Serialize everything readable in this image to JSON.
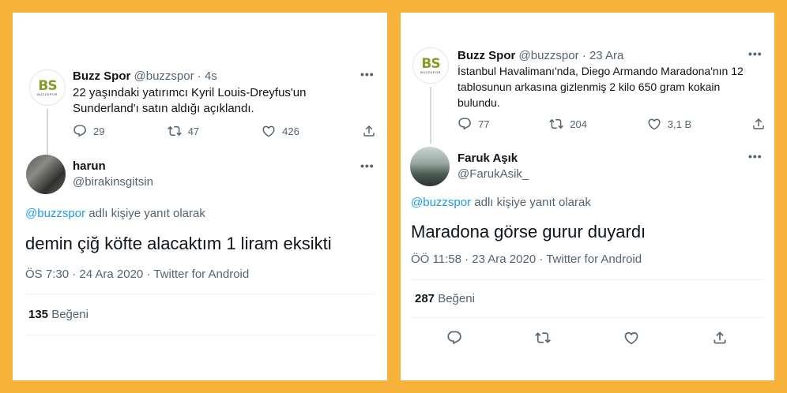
{
  "left": {
    "parent_tweet": {
      "avatar": {
        "letters": "BS",
        "sub": "BUZZSPOR"
      },
      "display_name": "Buzz Spor",
      "handle": "@buzzspor",
      "time": "· 4s",
      "text": "22 yaşındaki yatırımcı Kyril Louis-Dreyfus'un Sunderland'ı satın aldığı açıklandı.",
      "replies": "29",
      "retweets": "47",
      "likes": "426"
    },
    "reply_tweet": {
      "display_name": "harun",
      "handle": "@birakinsgitsin",
      "reply_mention": "@buzzspor",
      "reply_suffix": "adlı kişiye yanıt olarak",
      "text": "demin çiğ köfte alacaktım 1 liram eksikti",
      "meta": "ÖS 7:30 · 24 Ara 2020 · Twitter for Android",
      "likes_count": "135",
      "likes_label": "Beğeni"
    }
  },
  "right": {
    "parent_tweet": {
      "avatar": {
        "letters": "BS",
        "sub": "BUZZSPOR"
      },
      "display_name": "Buzz Spor",
      "handle": "@buzzspor",
      "time": "· 23 Ara",
      "text": "İstanbul Havalimanı'nda, Diego Armando Maradona'nın 12 tablosunun arkasına gizlenmiş 2 kilo 650 gram kokain bulundu.",
      "replies": "77",
      "retweets": "204",
      "likes": "3,1 B"
    },
    "reply_tweet": {
      "display_name": "Faruk Aşık",
      "handle": "@FarukAsik_",
      "reply_mention": "@buzzspor",
      "reply_suffix": "adlı kişiye yanıt olarak",
      "text": "Maradona görse gurur duyardı",
      "meta": "ÖÖ 11:58 · 23 Ara 2020 · Twitter for Android",
      "likes_count": "287",
      "likes_label": "Beğeni"
    }
  },
  "more_glyph": "•••",
  "colors": {
    "background": "#f7b23b",
    "link": "#1d9bf0",
    "muted": "#536471"
  }
}
